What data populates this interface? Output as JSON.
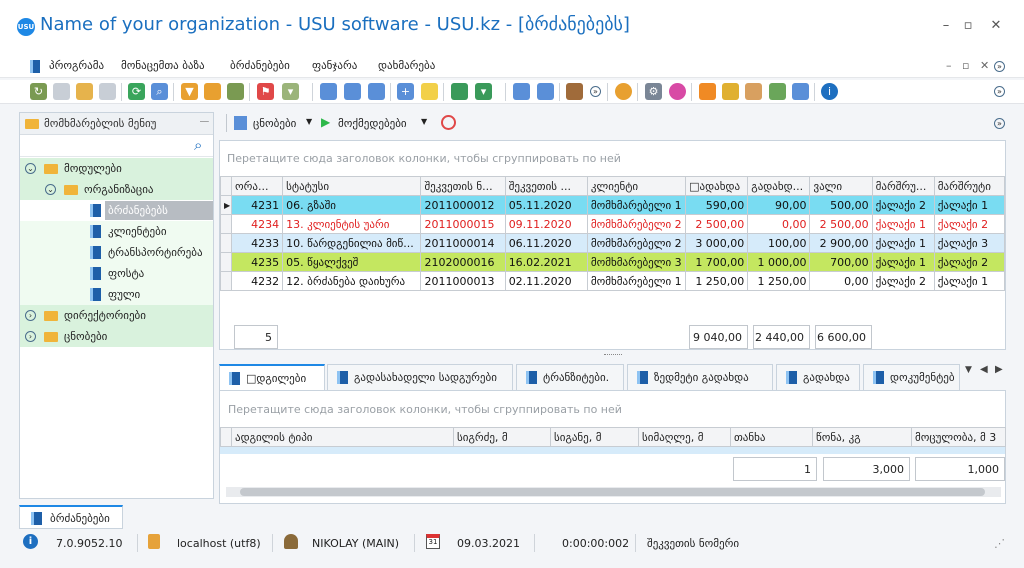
{
  "window": {
    "title": "Name of your organization - USU software - USU.kz - [ბრძანებებს]",
    "logo": "USU",
    "minimize": "–",
    "maximize": "▫",
    "close": "✕"
  },
  "menu": [
    "პროგრამა",
    "მონაცემთა ბაზა",
    "ბრძანებები",
    "ფანჯარა",
    "დახმარება"
  ],
  "left_panel": {
    "title": "მომხმარებლის მენიუ",
    "pin": "𝄖",
    "tree": [
      {
        "label": "მოდულები",
        "level": 0,
        "type": "folder",
        "state": "open"
      },
      {
        "label": "ორგანიზაცია",
        "level": 1,
        "type": "folder",
        "state": "open"
      },
      {
        "label": "ბრძანებებს",
        "level": 2,
        "type": "doc",
        "selected": true
      },
      {
        "label": "კლიენტები",
        "level": 2,
        "type": "doc"
      },
      {
        "label": "ტრანსპორტირება",
        "level": 2,
        "type": "doc"
      },
      {
        "label": "ფოსტა",
        "level": 2,
        "type": "doc"
      },
      {
        "label": "ფული",
        "level": 2,
        "type": "doc"
      },
      {
        "label": "დირექტორიები",
        "level": 0,
        "type": "folder",
        "state": "closed"
      },
      {
        "label": "ცნობები",
        "level": 0,
        "type": "folder",
        "state": "closed"
      }
    ]
  },
  "right_toolbar": {
    "reports": "ცნობები",
    "actions": "მოქმედებები"
  },
  "grid": {
    "group_hint": "Перетащите сюда заголовок колонки, чтобы сгруппировать по ней",
    "columns": [
      "ორა...",
      "სტატუსი",
      "შეკვეთის ნ...",
      "შეკვეთის ...",
      "კლიენტი",
      "□ადახდა",
      "გადახდ...",
      "ვალი",
      "მარშრუ...",
      "მარშრუტი"
    ],
    "rows": [
      {
        "cells": [
          "4231",
          "06. გზაში",
          "2011000012",
          "05.11.2020",
          "მომხმარებელი 1",
          "590,00",
          "90,00",
          "500,00",
          "ქალაქი 2",
          "ქალაქი 1"
        ],
        "style": "selected"
      },
      {
        "cells": [
          "4234",
          "13. კლიენტის უარი",
          "2011000015",
          "09.11.2020",
          "მომხმარებელი 2",
          "2 500,00",
          "0,00",
          "2 500,00",
          "ქალაქი 1",
          "ქალაქი 2"
        ],
        "style": "red"
      },
      {
        "cells": [
          "4233",
          "10. წარდგენილია მიწ...",
          "2011000014",
          "06.11.2020",
          "მომხმარებელი 2",
          "3 000,00",
          "100,00",
          "2 900,00",
          "ქალაქი 1",
          "ქალაქი 3"
        ],
        "style": "blue"
      },
      {
        "cells": [
          "4235",
          "05. წყალქვეშ",
          "2102000016",
          "16.02.2021",
          "მომხმარებელი 3",
          "1 700,00",
          "1 000,00",
          "700,00",
          "ქალაქი 1",
          "ქალაქი 2"
        ],
        "style": "green"
      },
      {
        "cells": [
          "4232",
          "12. ბრძანება დაიხურა",
          "2011000013",
          "02.11.2020",
          "მომხმარებელი 1",
          "1 250,00",
          "1 250,00",
          "0,00",
          "ქალაქი 2",
          "ქალაქი 1"
        ],
        "style": "white"
      }
    ],
    "totals": {
      "count": "5",
      "paid": "9 040,00",
      "payment": "2 440,00",
      "debt": "6 600,00"
    }
  },
  "tabs": [
    "□დგილები",
    "გადასახადელი სადგურები",
    "ტრანზიტები.",
    "ზედმეტი გადახდა",
    "გადახდა",
    "დოკუმენტებ"
  ],
  "grid2": {
    "group_hint": "Перетащите сюда заголовок колонки, чтобы сгруппировать по ней",
    "columns": [
      "ადგილის ტიპი",
      "სიგრძე, მ",
      "სიგანე, მ",
      "სიმაღლე, მ",
      "თანხა",
      "წონა, კგ",
      "მოცულობა, მ 3"
    ],
    "totals": [
      "1",
      "3,000",
      "1,000"
    ]
  },
  "status": {
    "tab": "ბრძანებები",
    "version": "7.0.9052.10",
    "server": "localhost (utf8)",
    "user": "NIKOLAY (MAIN)",
    "date": "09.03.2021",
    "timer": "0:00:00:002",
    "field": "შეკვეთის ნომერი"
  },
  "colors": {
    "accent": "#1e88e5",
    "selected_row": "#79dcf2",
    "red_text": "#e02020",
    "blue_row": "#d6ebfa",
    "green_row": "#c4e760"
  }
}
